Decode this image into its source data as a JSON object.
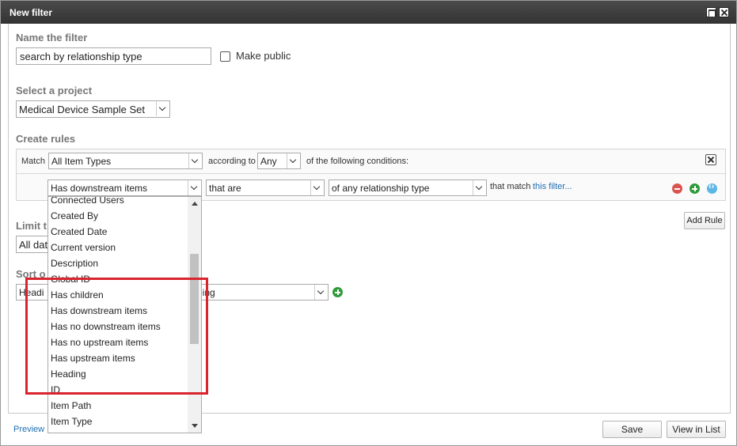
{
  "window": {
    "title": "New filter"
  },
  "name_section": {
    "label": "Name the filter",
    "value": "search by relationship type",
    "make_public_label": "Make public"
  },
  "project_section": {
    "label": "Select a project",
    "selected": "Medical Device Sample Set"
  },
  "rules_section": {
    "label": "Create rules",
    "match_label": "Match",
    "item_type_selected": "All Item Types",
    "according_to_label": "according to",
    "any_selected": "Any",
    "conditions_label": "of the following conditions:",
    "rule": {
      "field_selected": "Has downstream items",
      "operator_selected": "that are",
      "relationship_selected": "of any relationship type",
      "that_match_label": "that match",
      "filter_link": "this filter..."
    },
    "add_rule_label": "Add Rule"
  },
  "limit_section": {
    "label_partial": "Limit t",
    "selected_partial": "All dat"
  },
  "sort_section": {
    "label_partial": "Sort o",
    "field_partial": "Headi",
    "direction_partial": "ding"
  },
  "dropdown": {
    "items": [
      "Connected Users",
      "Created By",
      "Created Date",
      "Current version",
      "Description",
      "Global ID",
      "Has children",
      "Has downstream items",
      "Has no downstream items",
      "Has no upstream items",
      "Has upstream items",
      "Heading",
      "ID",
      "Item Path",
      "Item Type"
    ]
  },
  "footer": {
    "preview_link": "Preview",
    "save_label": "Save",
    "view_in_list_label": "View in List"
  },
  "colors": {
    "titlebar": "#333333",
    "highlight": "#d9232d",
    "link": "#1f6fb2"
  }
}
